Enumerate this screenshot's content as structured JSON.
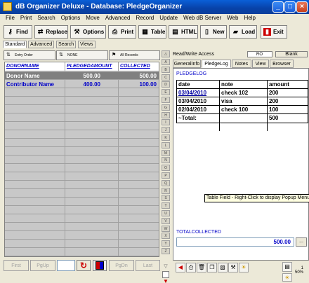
{
  "window": {
    "title": "dB Organizer Deluxe - Database: PledgeOrganizer",
    "minimize": "_",
    "maximize": "□",
    "close": "×"
  },
  "menu": [
    "File",
    "Print",
    "Search",
    "Options",
    "Move",
    "Advanced",
    "Record",
    "Update",
    "Web dB Server",
    "Web",
    "Help"
  ],
  "toolbar": {
    "find": "Find",
    "replace": "Replace",
    "options": "Options",
    "print": "Print",
    "table": "Table",
    "html": "HTML",
    "new": "New",
    "load": "Load",
    "exit": "Exit"
  },
  "view_tabs": [
    "Standard",
    "Advanced",
    "Search",
    "Views"
  ],
  "sort_bar": {
    "entry_order": "Entry Order",
    "none": "NONE",
    "all_records": "All Records"
  },
  "grid": {
    "columns": [
      "DONORNAME",
      "PLEDGEDAMOUNT",
      "COLLECTED"
    ],
    "rows": [
      {
        "name": "Donor Name",
        "pledged": "500.00",
        "collected": "500.00",
        "selected": true
      },
      {
        "name": "Contributor Name",
        "pledged": "400.00",
        "collected": "100.00",
        "selected": false
      }
    ]
  },
  "nav_bar": {
    "first": "First",
    "pgup": "PgUp",
    "pgdn": "PgDn",
    "last": "Last"
  },
  "letters": [
    "A",
    "B",
    "C",
    "D",
    "E",
    "F",
    "G",
    "H",
    "I",
    "J",
    "K",
    "L",
    "M",
    "N",
    "O",
    "P",
    "Q",
    "R",
    "S",
    "T",
    "U",
    "V",
    "W",
    "X",
    "Y",
    "Z"
  ],
  "right_panel": {
    "access": "Read/Write Access",
    "ro": "RO",
    "blank": "Blank",
    "tabs": [
      "GeneralInfo",
      "PledgeLog",
      "Notes",
      "View",
      "Browser"
    ],
    "active_tab": "PledgeLog",
    "pledgelog_label": "PLEDGELOG",
    "table": {
      "headers": [
        "date",
        "note",
        "amount"
      ],
      "rows": [
        [
          "03/04/2010",
          "check 102",
          "200"
        ],
        [
          "03/04/2010",
          "visa",
          "200"
        ],
        [
          "02/04/2010",
          "check 100",
          "100"
        ],
        [
          "~Total:",
          "",
          "500"
        ]
      ]
    },
    "tooltip": "Table Field - Right-Click to display Popup Menu",
    "totalcollected_label": "TOTALCOLLECTED",
    "totalcollected_value": "500.00",
    "ellipsis": "..."
  },
  "zoom": "50%",
  "zoom_top": "1"
}
